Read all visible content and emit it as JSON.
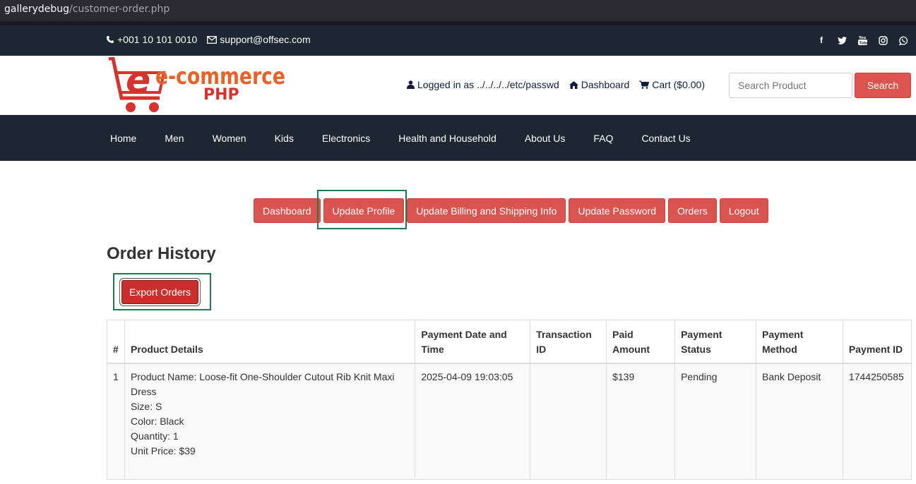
{
  "browser": {
    "url_host": "gallerydebug",
    "url_path": "/customer-order.php"
  },
  "topbar": {
    "phone": "+001 10 101 0010",
    "email": "support@offsec.com",
    "social_icons": [
      "facebook-icon",
      "twitter-icon",
      "youtube-icon",
      "instagram-icon",
      "whatsapp-icon"
    ]
  },
  "header": {
    "logo_text_main": "e-commerce",
    "logo_text_sub": "PHP",
    "logged_in_label": "Logged in as ../../../../etc/passwd",
    "dashboard_link": "Dashboard",
    "cart_link": "Cart ($0.00)",
    "search_placeholder": "Search Product",
    "search_button": "Search"
  },
  "nav": {
    "items": [
      "Home",
      "Men",
      "Women",
      "Kids",
      "Electronics",
      "Health and Household",
      "About Us",
      "FAQ",
      "Contact Us"
    ]
  },
  "account_buttons": [
    "Dashboard",
    "Update Profile",
    "Update Billing and Shipping Info",
    "Update Password",
    "Orders",
    "Logout"
  ],
  "page_title": "Order History",
  "export_button": "Export Orders",
  "table": {
    "headers": [
      "#",
      "Product Details",
      "Payment Date and Time",
      "Transaction ID",
      "Paid Amount",
      "Payment Status",
      "Payment Method",
      "Payment ID"
    ],
    "rows": [
      {
        "num": "1",
        "product_lines": [
          "Product Name: Loose-fit One-Shoulder Cutout Rib Knit Maxi Dress",
          "Size: S",
          "Color: Black",
          "Quantity: 1",
          "Unit Price: $39"
        ],
        "payment_date": "2025-04-09 19:03:05",
        "transaction_id": "",
        "paid_amount": "$139",
        "payment_status": "Pending",
        "payment_method": "Bank Deposit",
        "payment_id": "1744250585"
      }
    ]
  },
  "colors": {
    "accent_red": "#d9534f",
    "dark_bar": "#1d2731",
    "highlight_green": "#1e7a4f",
    "logo_orange": "#e8632b"
  }
}
